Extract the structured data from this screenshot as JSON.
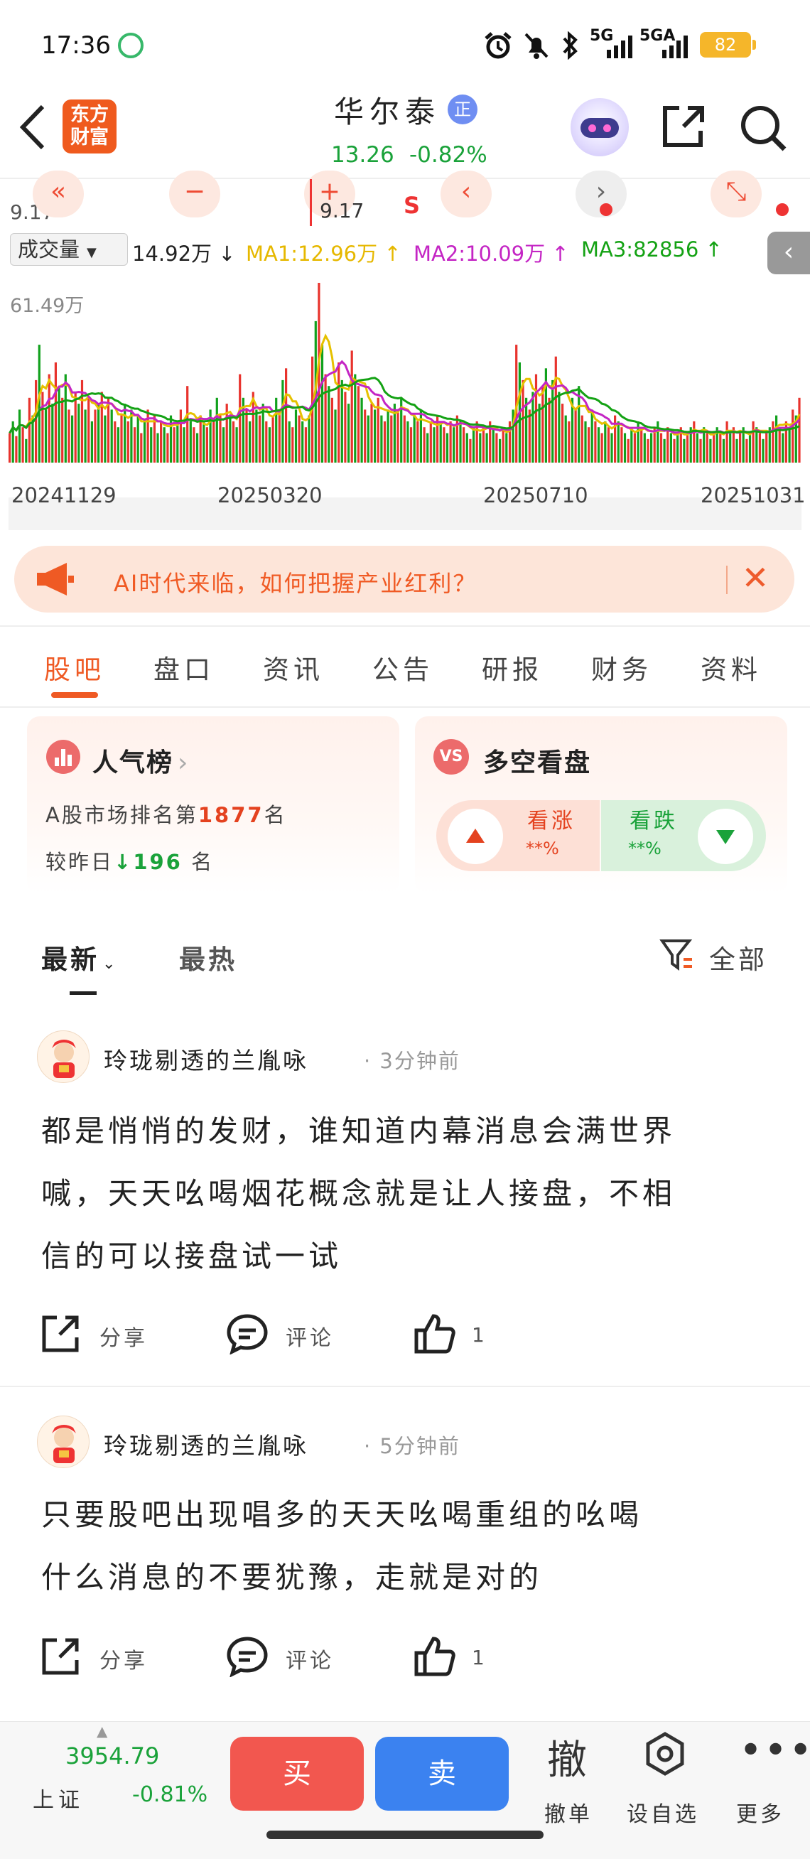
{
  "status_bar": {
    "time": "17:36",
    "battery": "82",
    "net1": "5G",
    "net2": "5GA"
  },
  "header": {
    "logo_line1": "东方",
    "logo_line2": "财富",
    "stock_name": "华尔泰",
    "badge": "正",
    "price": "13.26",
    "change_pct": "-0.82%"
  },
  "chart_toolbar": {
    "price_left": "9.17",
    "crosshair_price": "9.17",
    "s_marker": "S"
  },
  "volume_bar": {
    "selector": "成交量",
    "volume": "14.92万",
    "ma1_label": "MA1:12.96万",
    "ma2_label": "MA2:10.09万",
    "ma3_label": "MA3:82856",
    "colors": {
      "ma1": "#e6c100",
      "ma2": "#c425c4",
      "ma3": "#14a214",
      "up": "#e8332d",
      "down": "#11a11d"
    }
  },
  "chart_data": {
    "type": "bar",
    "max_label": "61.49万",
    "x_tick_labels": [
      "20241129",
      "20250320",
      "20250710",
      "20251031"
    ],
    "ylim": [
      0,
      61.49
    ],
    "unit": "万",
    "volumes": [
      10,
      14,
      9,
      18,
      12,
      8,
      22,
      16,
      28,
      40,
      24,
      18,
      30,
      20,
      34,
      26,
      22,
      30,
      18,
      16,
      24,
      20,
      28,
      18,
      22,
      14,
      18,
      20,
      24,
      16,
      22,
      18,
      14,
      12,
      16,
      20,
      14,
      18,
      12,
      16,
      10,
      14,
      18,
      12,
      16,
      10,
      14,
      12,
      10,
      16,
      12,
      14,
      18,
      12,
      26,
      14,
      12,
      10,
      16,
      14,
      12,
      18,
      14,
      22,
      16,
      12,
      20,
      16,
      14,
      12,
      30,
      22,
      18,
      14,
      24,
      18,
      16,
      20,
      14,
      12,
      16,
      22,
      18,
      28,
      32,
      14,
      12,
      18,
      16,
      14,
      12,
      16,
      36,
      48,
      61,
      40,
      30,
      26,
      22,
      18,
      34,
      28,
      24,
      20,
      38,
      30,
      26,
      22,
      18,
      16,
      20,
      18,
      22,
      16,
      14,
      18,
      16,
      20,
      18,
      22,
      16,
      14,
      12,
      16,
      14,
      18,
      12,
      10,
      14,
      12,
      16,
      14,
      12,
      10,
      14,
      12,
      16,
      14,
      12,
      10,
      8,
      12,
      14,
      10,
      12,
      10,
      14,
      12,
      10,
      8,
      12,
      10,
      14,
      18,
      40,
      34,
      28,
      22,
      18,
      24,
      30,
      20,
      26,
      32,
      22,
      28,
      36,
      24,
      20,
      16,
      14,
      22,
      18,
      26,
      16,
      14,
      12,
      18,
      14,
      12,
      10,
      14,
      12,
      10,
      16,
      14,
      12,
      10,
      8,
      12,
      10,
      14,
      12,
      10,
      8,
      10,
      12,
      14,
      10,
      8,
      12,
      10,
      8,
      10,
      12,
      8,
      10,
      12,
      14,
      10,
      8,
      12,
      10,
      8,
      10,
      12,
      10,
      8,
      14,
      10,
      12,
      8,
      10,
      12,
      8,
      10,
      14,
      12,
      10,
      8,
      10,
      12,
      14,
      16,
      12,
      10,
      14,
      12,
      18,
      16,
      22
    ],
    "up_down": "alternating"
  },
  "banner": {
    "text": "AI时代来临，如何把握产业红利？"
  },
  "tabs": [
    "股吧",
    "盘口",
    "资讯",
    "公告",
    "研报",
    "财务",
    "资料"
  ],
  "popularity_card": {
    "title": "人气榜",
    "line1_pre": "A股市场排名第",
    "rank": "1877",
    "line1_post": "名",
    "line2_pre": "较昨日",
    "delta": "196",
    "line2_post": "名"
  },
  "sentiment_card": {
    "title": "多空看盘",
    "bull_label": "看涨",
    "bull_value": "**%",
    "bear_label": "看跌",
    "bear_value": "**%"
  },
  "filter": {
    "latest": "最新",
    "hot": "最热",
    "all": "全部"
  },
  "posts": [
    {
      "user": "玲珑剔透的兰胤咏",
      "time": "· 3分钟前",
      "line1": "都是悄悄的发财，谁知道内幕消息会满世界",
      "line2": "喊，天天吆喝烟花概念就是让人接盘，不相",
      "line3": "信的可以接盘试一试",
      "share": "分享",
      "comment": "评论",
      "likes": "1"
    },
    {
      "user": "玲珑剔透的兰胤咏",
      "time": "· 5分钟前",
      "line1": "只要股吧出现唱多的天天吆喝重组的吆喝",
      "line2": "什么消息的不要犹豫，走就是对的",
      "share": "分享",
      "comment": "评论",
      "likes": "1"
    }
  ],
  "bottom_bar": {
    "index_value": "3954.79",
    "index_name": "上证",
    "index_change": "-0.81%",
    "buy": "买",
    "sell": "卖",
    "cancel_icon_char": "撤",
    "cancel_label": "撤单",
    "watchlist_label": "设自选",
    "more_label": "更多"
  }
}
